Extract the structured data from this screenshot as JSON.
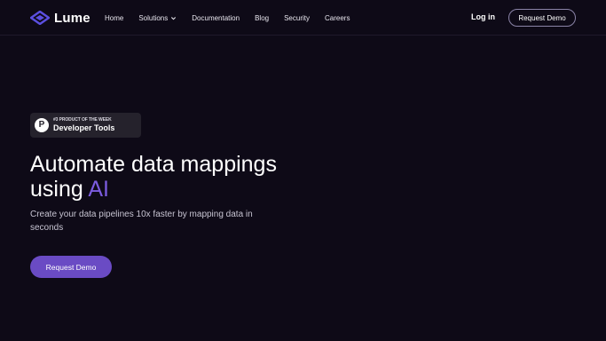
{
  "brand": {
    "name": "Lume",
    "logo_icon": "layered-diamond-icon",
    "accent_color": "#6a4bc4"
  },
  "nav": {
    "links": [
      "Home",
      "Solutions",
      "Documentation",
      "Blog",
      "Security",
      "Careers"
    ],
    "login_label": "Log in",
    "demo_label": "Request Demo"
  },
  "badge": {
    "icon": "product-hunt-icon",
    "icon_letter": "P",
    "small_text": "#3 PRODUCT OF THE WEEK",
    "big_text": "Developer Tools"
  },
  "hero": {
    "headline_line1": "Automate data mappings",
    "headline_line2_prefix": "using ",
    "headline_highlight": "AI",
    "subtitle": "Create your data pipelines 10x faster by mapping data in seconds",
    "cta_label": "Request Demo"
  }
}
